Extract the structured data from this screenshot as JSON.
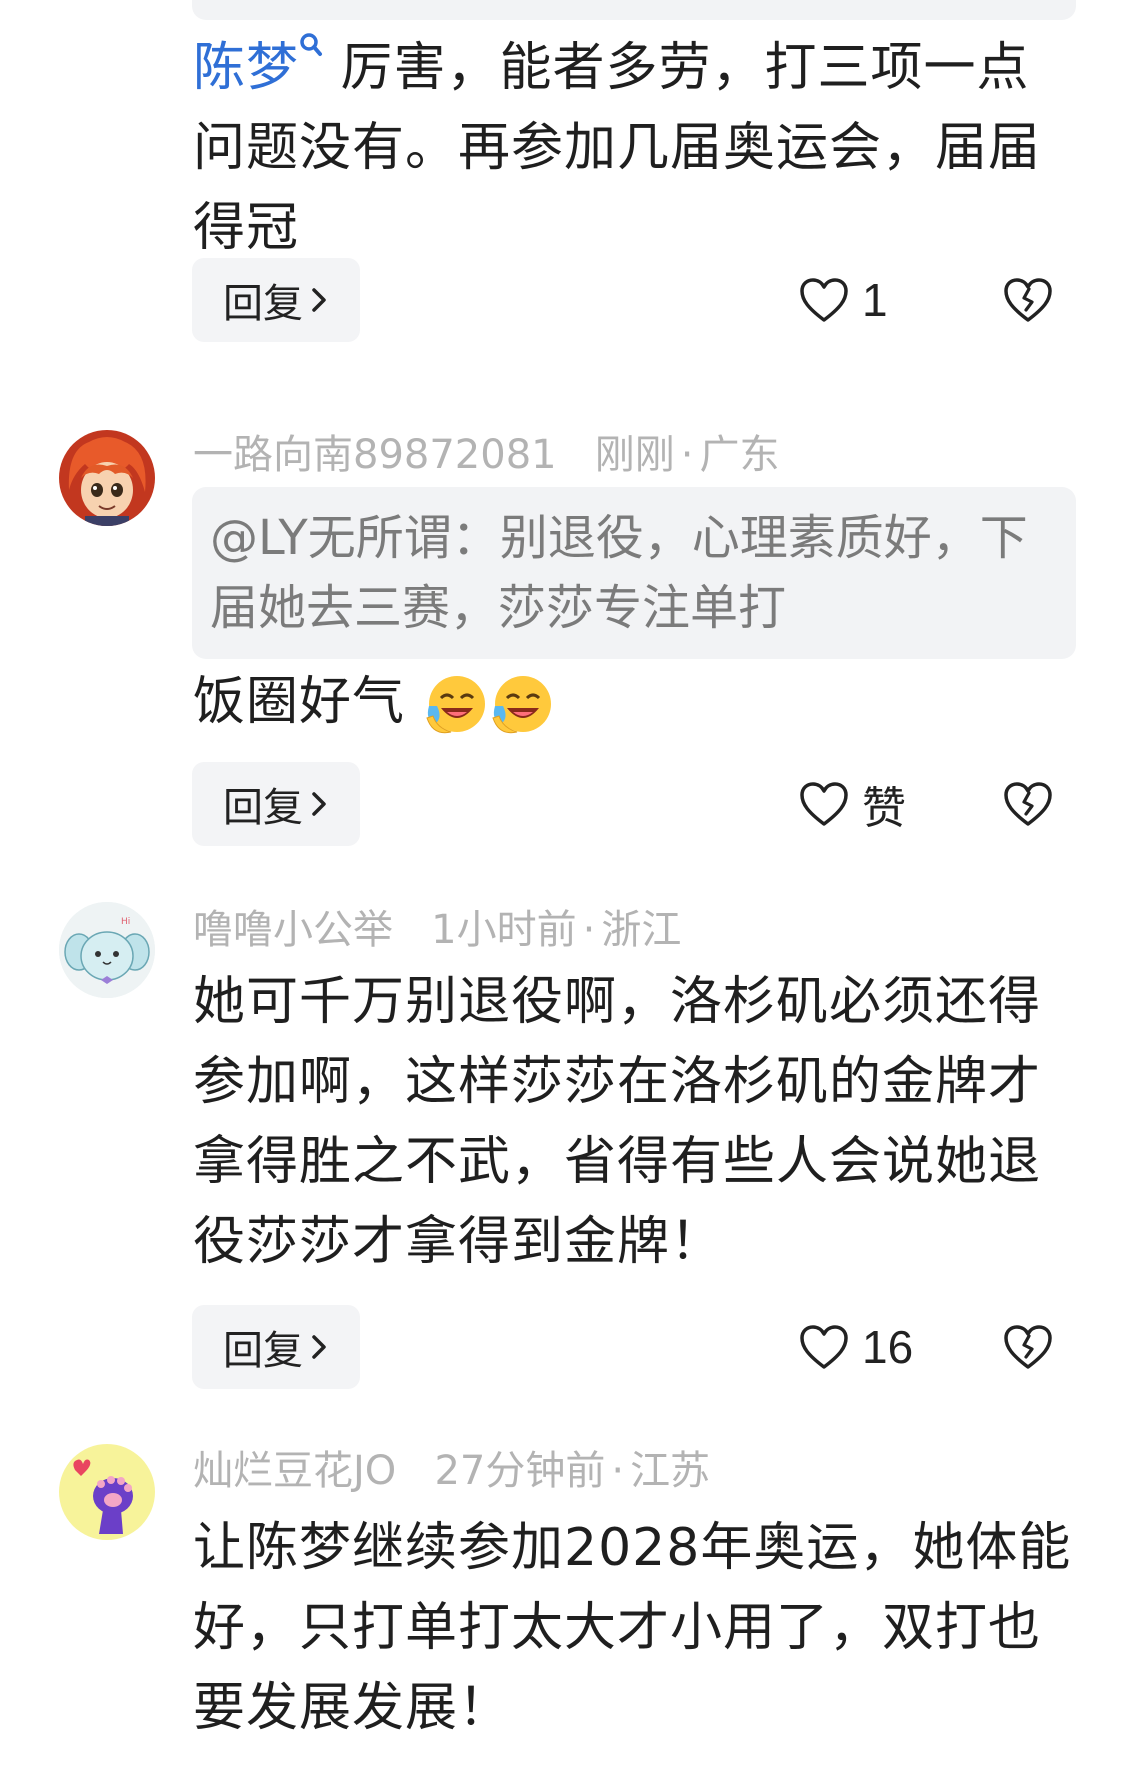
{
  "comments": [
    {
      "mention": "陈梦",
      "text": "厉害，能者多劳，打三项一点问题没有。再参加几届奥运会，届届得冠",
      "reply_label": "回复",
      "like_count": "1"
    },
    {
      "username": "一路向南89872081",
      "time": "刚刚",
      "location": "广东",
      "quote": "@LY无所谓：别退役，心理素质好，下届她去三赛，莎莎专注单打",
      "text": "饭圈好气",
      "emojis": [
        "crying-laughing-emoji",
        "crying-laughing-emoji"
      ],
      "reply_label": "回复",
      "like_label": "赞"
    },
    {
      "username": "噜噜小公举",
      "time": "1小时前",
      "location": "浙江",
      "text": "她可千万别退役啊，洛杉矶必须还得参加啊，这样莎莎在洛杉矶的金牌才拿得胜之不武，省得有些人会说她退役莎莎才拿得到金牌！",
      "reply_label": "回复",
      "like_count": "16"
    },
    {
      "username": "灿烂豆花JO",
      "time": "27分钟前",
      "location": "江苏",
      "text": "让陈梦继续参加2028年奥运，她体能好，只打单打太大才小用了，双打也要发展发展！"
    }
  ],
  "separator": "·",
  "colors": {
    "mention": "#2f6fd6",
    "meta": "#b3b3b3",
    "quote_bg": "#f2f3f5",
    "button_bg": "#f3f4f6"
  },
  "icons": [
    "search-icon",
    "chevron-right-icon",
    "heart-outline-icon",
    "broken-heart-icon"
  ]
}
